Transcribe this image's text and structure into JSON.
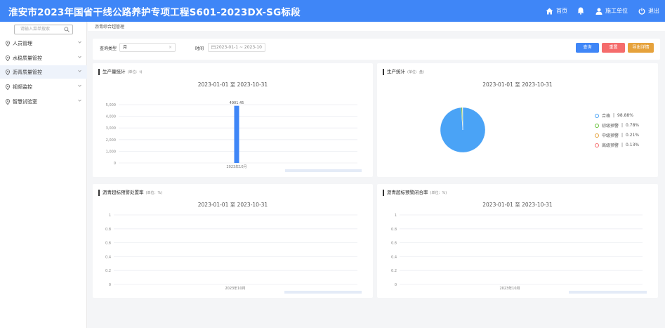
{
  "header": {
    "title": "淮安市2023年国省干线公路养护专项工程S601-2023DX-SG标段",
    "home_label": "首页",
    "user_label": "施工单位",
    "logout_label": "退出",
    "colors": {
      "bar": "#3f86f7"
    }
  },
  "sidebar": {
    "search_placeholder": "请输入菜单搜索",
    "items": [
      {
        "label": "人员管理",
        "icon": "location-pin-icon"
      },
      {
        "label": "水稳质量管控",
        "icon": "location-pin-icon"
      },
      {
        "label": "沥青质量管控",
        "icon": "location-pin-icon"
      },
      {
        "label": "视频监控",
        "icon": "location-pin-icon"
      },
      {
        "label": "智慧试验室",
        "icon": "location-pin-icon"
      }
    ]
  },
  "breadcrumb": "沥青综合超管理",
  "filters": {
    "query_type_label": "查询类型",
    "query_type_value": "月",
    "time_label": "时间",
    "time_value": "2023-01-1 ~ 2023-10",
    "query_button": "查询",
    "reset_button": "重置",
    "export_button": "导出详情"
  },
  "colors": {
    "primary": "#3f86f7",
    "danger": "#f56c6c",
    "warning": "#e6a23c",
    "pie_pass": "#4aa3f6",
    "pie_mid": "#e6a23c",
    "pie_high": "#f56c6c",
    "pie_low": "#67c23a"
  },
  "panels": {
    "production": {
      "title": "生产量统计",
      "unit": "(单位：t)",
      "date": "2023-01-01 至 2023-10-31"
    },
    "warning": {
      "title": "生产统计",
      "unit": "(单位：盘)",
      "date": "2023-01-01 至 2023-10-31"
    },
    "rate1": {
      "title": "沥青超标预警处置率",
      "unit": "(单位：%)",
      "date": "2023-01-01 至 2023-10-31"
    },
    "rate2": {
      "title": "沥青超标预警闭合率",
      "unit": "(单位：%)",
      "date": "2023-01-01 至 2023-10-31"
    }
  },
  "chart_data": [
    {
      "type": "bar",
      "categories": [
        "2023年10月"
      ],
      "values": [
        4901.45
      ],
      "data_labels": [
        "4901.45"
      ],
      "ylim": [
        0,
        5000
      ],
      "yticks": [
        "0",
        "1,000",
        "2,000",
        "3,000",
        "4,000",
        "5,000"
      ],
      "grid": true
    },
    {
      "type": "pie",
      "legend_position": "right",
      "slices": [
        {
          "name": "合格",
          "percent": 98.88,
          "label": "98.88%"
        },
        {
          "name": "初级预警",
          "percent": 0.78,
          "label": "0.78%"
        },
        {
          "name": "中级预警",
          "percent": 0.21,
          "label": "0.21%"
        },
        {
          "name": "高级预警",
          "percent": 0.13,
          "label": "0.13%"
        }
      ]
    },
    {
      "type": "bar",
      "categories": [
        "2023年10月"
      ],
      "values": [],
      "ylim": [
        0,
        1
      ],
      "yticks": [
        "0",
        "0.2",
        "0.4",
        "0.6",
        "0.8",
        "1"
      ],
      "grid": true
    },
    {
      "type": "bar",
      "categories": [
        "2023年10月"
      ],
      "values": [],
      "ylim": [
        0,
        1
      ],
      "yticks": [
        "0",
        "0.2",
        "0.4",
        "0.6",
        "0.8",
        "1"
      ],
      "grid": true
    }
  ]
}
